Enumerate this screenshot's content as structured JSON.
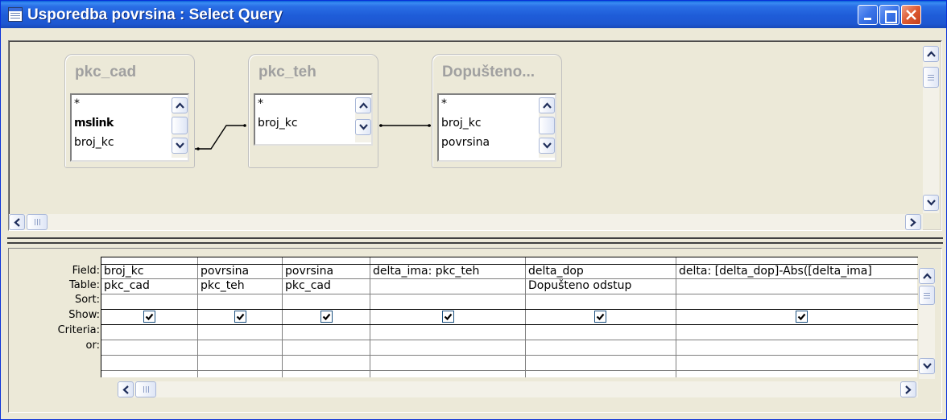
{
  "window": {
    "title": "Usporedba povrsina : Select Query"
  },
  "title_buttons": [
    "minimize",
    "maximize",
    "close"
  ],
  "tables": [
    {
      "name": "pkc_cad",
      "fields": [
        "*",
        "mslink",
        "broj_kc"
      ],
      "primary_key": "mslink"
    },
    {
      "name": "pkc_teh",
      "fields": [
        "*",
        "broj_kc"
      ]
    },
    {
      "name": "Dopušteno...",
      "fields": [
        "*",
        "broj_kc",
        "povrsina"
      ]
    }
  ],
  "grid": {
    "row_labels": [
      "Field:",
      "Table:",
      "Sort:",
      "Show:",
      "Criteria:",
      "or:"
    ],
    "columns": [
      {
        "field": "broj_kc",
        "table": "pkc_cad",
        "sort": "",
        "show": true,
        "criteria": "",
        "or": ""
      },
      {
        "field": "povrsina",
        "table": "pkc_teh",
        "sort": "",
        "show": true,
        "criteria": "",
        "or": ""
      },
      {
        "field": "povrsina",
        "table": "pkc_cad",
        "sort": "",
        "show": true,
        "criteria": "",
        "or": ""
      },
      {
        "field": "delta_ima: pkc_teh",
        "table": "",
        "sort": "",
        "show": true,
        "criteria": "",
        "or": ""
      },
      {
        "field": "delta_dop",
        "table": "Dopušteno odstup",
        "sort": "",
        "show": true,
        "criteria": "",
        "or": ""
      },
      {
        "field": "delta: [delta_dop]-Abs([delta_ima]",
        "table": "",
        "sort": "",
        "show": true,
        "criteria": "",
        "or": ""
      }
    ]
  },
  "icons": {
    "title": "query-window-icon",
    "scroll_up": "arrow-up-icon",
    "scroll_down": "arrow-down-icon",
    "scroll_left": "arrow-left-icon",
    "scroll_right": "arrow-right-icon",
    "checkbox": "check-icon"
  },
  "colors": {
    "titlebar": "#1E5CD8",
    "close_button": "#DD5A32",
    "table_title": "#A0A0A0"
  }
}
